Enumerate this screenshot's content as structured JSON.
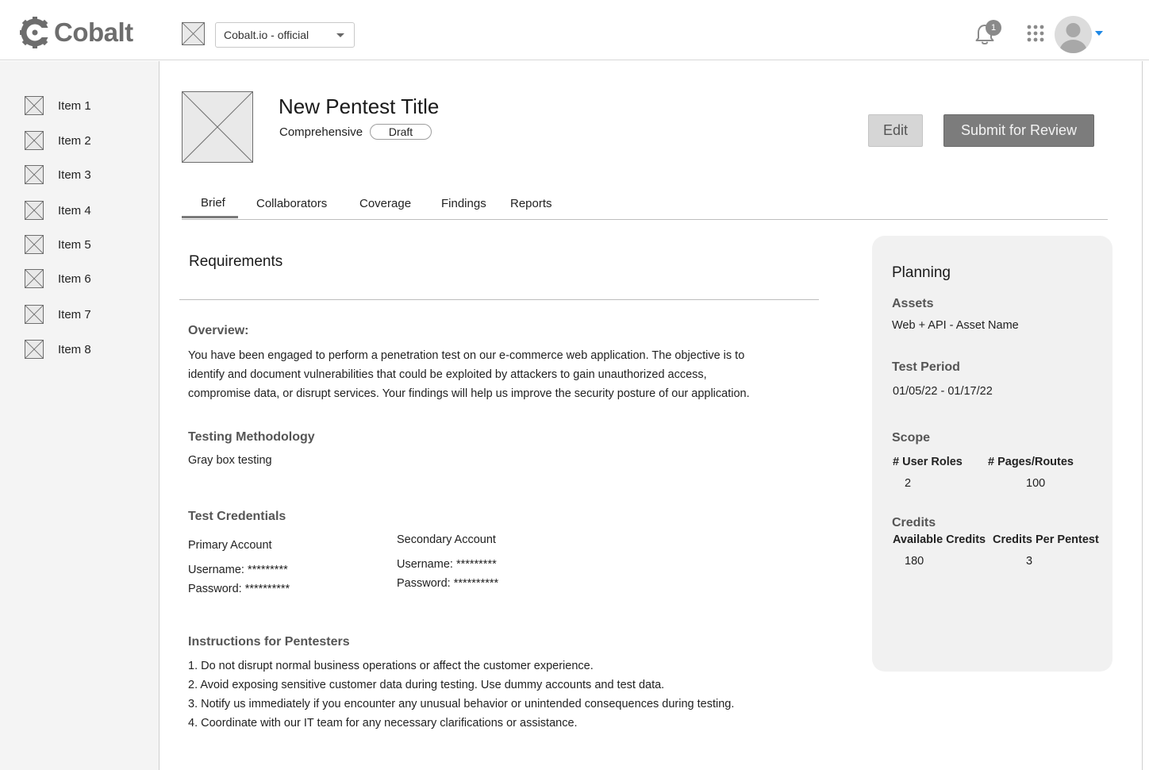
{
  "header": {
    "logo_text": "Cobalt",
    "org_select": "Cobalt.io - official",
    "notification_count": "1"
  },
  "sidebar": {
    "items": [
      {
        "label": "Item 1"
      },
      {
        "label": "Item 2"
      },
      {
        "label": "Item 3"
      },
      {
        "label": "Item 4"
      },
      {
        "label": "Item 5"
      },
      {
        "label": "Item 6"
      },
      {
        "label": "Item 7"
      },
      {
        "label": "Item 8"
      }
    ]
  },
  "pentest": {
    "title": "New Pentest Title",
    "type": "Comprehensive",
    "status": "Draft",
    "edit_label": "Edit",
    "submit_label": "Submit for Review"
  },
  "tabs": [
    {
      "label": "Brief",
      "active": true
    },
    {
      "label": "Collaborators"
    },
    {
      "label": "Coverage"
    },
    {
      "label": "Findings"
    },
    {
      "label": "Reports"
    }
  ],
  "requirements": {
    "title": "Requirements",
    "overview_heading": "Overview:",
    "overview_lines": [
      "You have been engaged to perform a penetration test on our e-commerce web application. The objective is to",
      "identify and document vulnerabilities that could be exploited by attackers to gain unauthorized access,",
      "compromise data, or disrupt services. Your findings will help us improve the security posture of our application."
    ],
    "methodology_heading": "Testing Methodology",
    "methodology_value": "Gray box testing",
    "credentials_heading": "Test Credentials",
    "primary": {
      "label": "Primary Account",
      "username": "Username: *********",
      "password": "Password: **********"
    },
    "secondary": {
      "label": "Secondary Account",
      "username": "Username: *********",
      "password": "Password: **********"
    },
    "instructions_heading": "Instructions for Pentesters",
    "instructions": [
      "1. Do not disrupt normal business operations or affect the customer experience.",
      "2. Avoid exposing sensitive customer data during testing. Use dummy accounts and test data.",
      "3. Notify us immediately if you encounter any unusual behavior or unintended consequences during testing.",
      "4. Coordinate with our IT team for any necessary clarifications or assistance."
    ]
  },
  "planning": {
    "title": "Planning",
    "assets_heading": "Assets",
    "assets_value": "Web + API - Asset Name",
    "period_heading": "Test Period",
    "period_value": "01/05/22 - 01/17/22",
    "scope_heading": "Scope",
    "user_roles_label": "# User Roles",
    "user_roles_value": "2",
    "pages_label": "# Pages/Routes",
    "pages_value": "100",
    "credits_heading": "Credits",
    "available_label": "Available Credits",
    "available_value": "180",
    "per_pentest_label": "Credits Per Pentest",
    "per_pentest_value": "3"
  },
  "colors": {
    "accent": "#1e88e5",
    "logo": "#6d6d6d",
    "submit_bg": "#7c7c7c",
    "edit_bg": "#d6d6d6",
    "panel_bg": "#f1f1f1"
  }
}
